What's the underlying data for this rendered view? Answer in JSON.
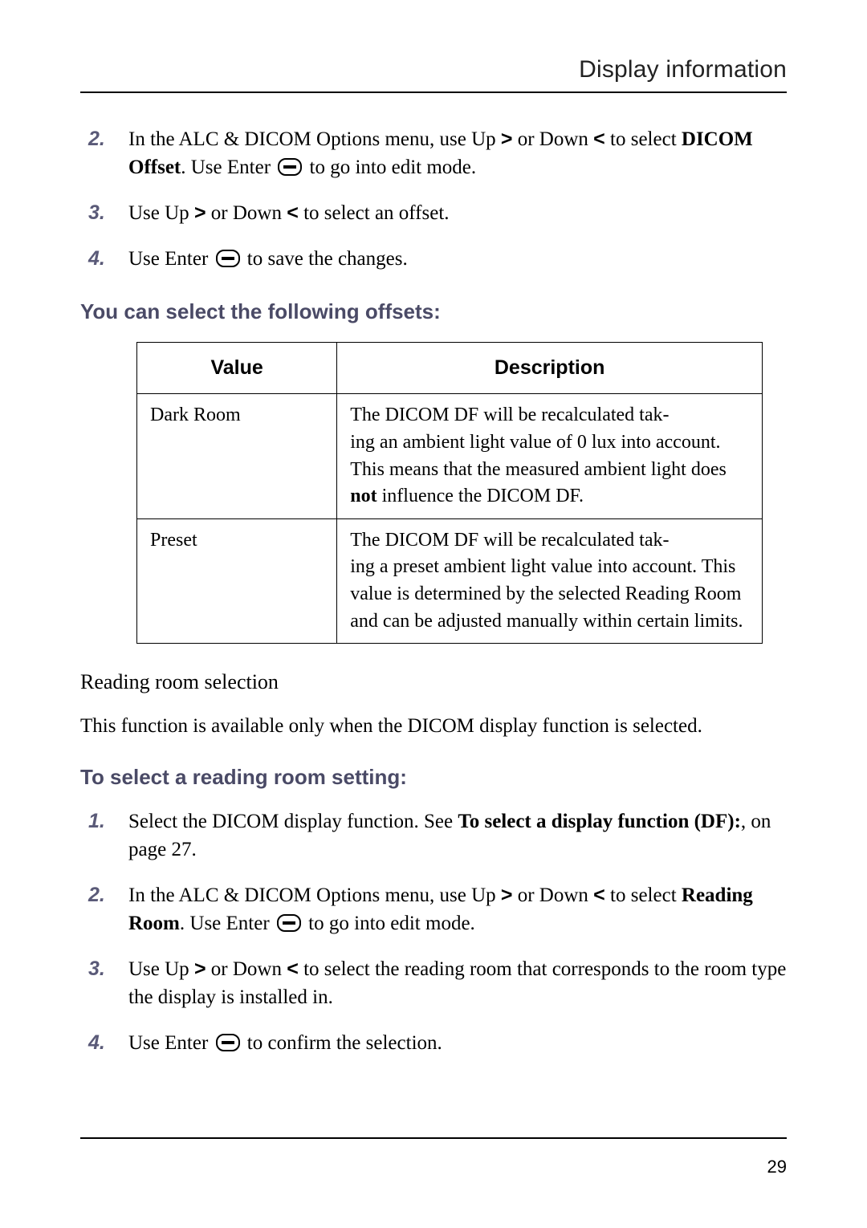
{
  "header": {
    "title": "Display information"
  },
  "steps_top": [
    {
      "num": "2.",
      "html": "In the ALC & DICOM Options menu, use Up <span class='chev'>&gt;</span> or Down <span class='chev'>&lt;</span> to select <b>DICOM Offset</b>. Use Enter <span class='ico ico-enter' data-name='enter-icon' data-interactable='false'></span> to go into edit mode."
    },
    {
      "num": "3.",
      "html": "Use Up <span class='chev'>&gt;</span> or Down <span class='chev'>&lt;</span> to select an offset."
    },
    {
      "num": "4.",
      "html": "Use Enter <span class='ico ico-enter' data-name='enter-icon' data-interactable='false'></span> to save the changes."
    }
  ],
  "offsets_head": "You can select the following offsets:",
  "table": {
    "col1": "Value",
    "col2": "Description",
    "rows": [
      {
        "value": "Dark Room",
        "desc_html": "The DICOM DF will be recalculated tak-<br>ing an ambient light value of 0 lux into account.<br>This means that the measured ambient light does <b>not</b> influence the DICOM DF."
      },
      {
        "value": "Preset",
        "desc_html": "The DICOM DF will be recalculated tak-<br>ing a preset ambient light value into account. This value is determined by the selected Reading Room and can be adjusted manually within certain limits."
      }
    ]
  },
  "reading_room_head": "Reading room selection",
  "reading_room_para": "This function is available only when the DICOM display function is selected.",
  "select_reading_head": "To select a reading room setting:",
  "steps_bottom": [
    {
      "num": "1.",
      "html": "Select the DICOM display function. See <b>To select a display function (DF):</b>, on page 27."
    },
    {
      "num": "2.",
      "html": "In the ALC & DICOM Options menu, use Up <span class='chev'>&gt;</span> or Down <span class='chev'>&lt;</span> to select <b>Reading Room</b>. Use Enter <span class='ico ico-enter' data-name='enter-icon' data-interactable='false'></span> to go into edit mode."
    },
    {
      "num": "3.",
      "html": "Use Up <span class='chev'>&gt;</span> or Down <span class='chev'>&lt;</span> to select the reading room that corresponds to the room type the display is installed in."
    },
    {
      "num": "4.",
      "html": "Use Enter <span class='ico ico-enter' data-name='enter-icon' data-interactable='false'></span> to confirm the selection."
    }
  ],
  "page_number": "29"
}
